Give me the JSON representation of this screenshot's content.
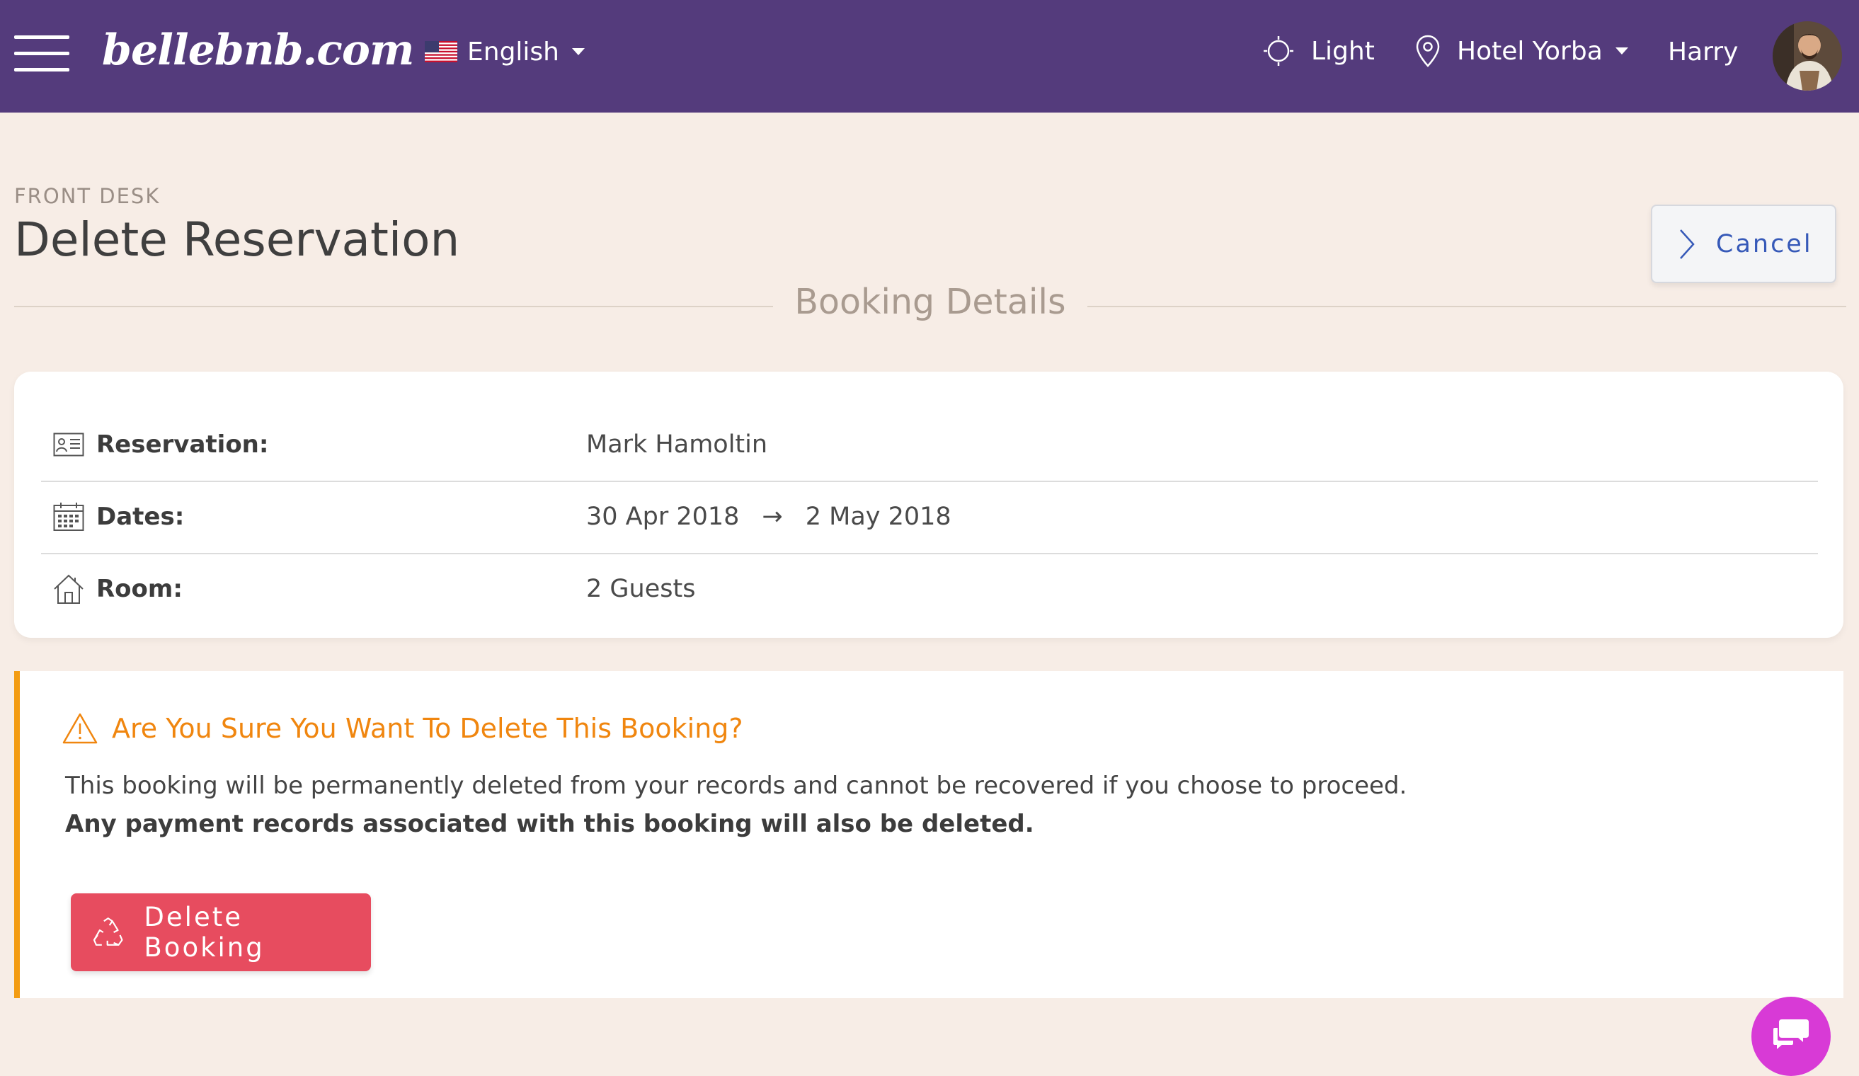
{
  "header": {
    "logo": "bellebnb.com",
    "language": "English",
    "theme": "Light",
    "hotel": "Hotel Yorba",
    "user": "Harry"
  },
  "page": {
    "breadcrumb": "FRONT DESK",
    "title": "Delete Reservation",
    "cancel_label": "Cancel",
    "section_title": "Booking Details"
  },
  "booking": {
    "reservation_label": "Reservation:",
    "reservation_value": "Mark Hamoltin",
    "dates_label": "Dates:",
    "date_from": "30 Apr 2018",
    "date_arrow": "→",
    "date_to": "2 May 2018",
    "room_label": "Room:",
    "room_value": "2 Guests"
  },
  "warning": {
    "title": "Are You Sure You Want To Delete This Booking?",
    "text": "This booking will be permanently deleted from your records and cannot be recovered if you choose to proceed.",
    "text_bold": "Any payment records associated with this booking will also be deleted.",
    "delete_label": "Delete Booking"
  },
  "colors": {
    "header_bg": "#543b7c",
    "page_bg": "#f7ede6",
    "accent_blue": "#3659b8",
    "warning_orange": "#f0860f",
    "danger_red": "#e74c5f",
    "chat_magenta": "#d83ad6"
  },
  "icons": {
    "menu": "hamburger-icon",
    "flag": "us-flag-icon",
    "theme": "sun-icon",
    "hotel": "map-pin-icon",
    "cancel": "chevron-right-icon",
    "reservation": "id-card-icon",
    "dates": "calendar-icon",
    "room": "house-icon",
    "warning": "warning-triangle-icon",
    "delete": "recycle-icon",
    "chat": "chat-icon"
  }
}
